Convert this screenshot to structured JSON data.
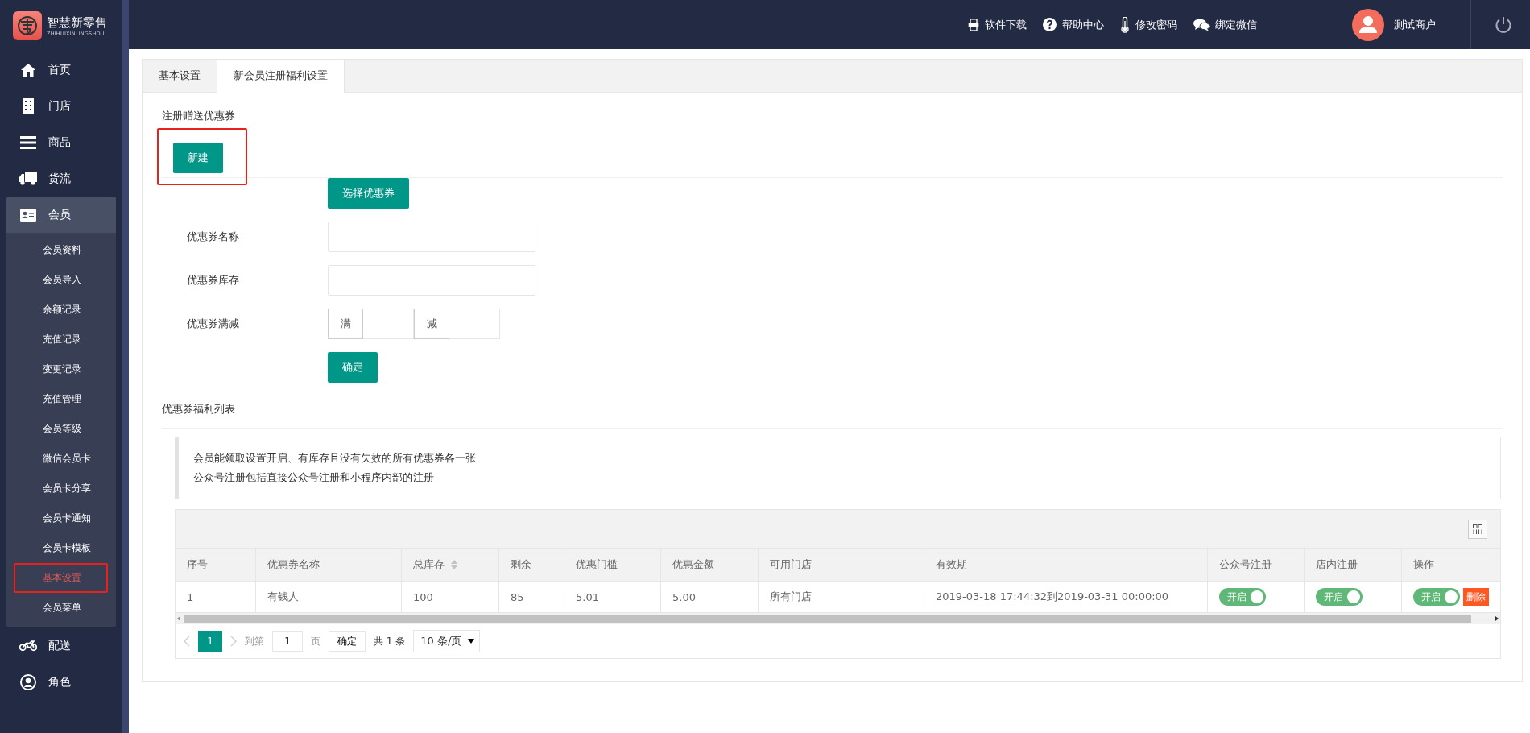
{
  "logo": {
    "title": "智慧新零售",
    "subtitle": "ZHIHUIXINLINGSHOU"
  },
  "sidebar": {
    "items": [
      {
        "label": "首页",
        "selected": false
      },
      {
        "label": "门店",
        "selected": false
      },
      {
        "label": "商品",
        "selected": false
      },
      {
        "label": "货流",
        "selected": false
      },
      {
        "label": "会员",
        "selected": true,
        "expanded": true,
        "children": [
          {
            "label": "会员资料",
            "selected": false
          },
          {
            "label": "会员导入",
            "selected": false
          },
          {
            "label": "余额记录",
            "selected": false
          },
          {
            "label": "充值记录",
            "selected": false
          },
          {
            "label": "变更记录",
            "selected": false
          },
          {
            "label": "充值管理",
            "selected": false
          },
          {
            "label": "会员等级",
            "selected": false
          },
          {
            "label": "微信会员卡",
            "selected": false
          },
          {
            "label": "会员卡分享",
            "selected": false
          },
          {
            "label": "会员卡通知",
            "selected": false
          },
          {
            "label": "会员卡模板",
            "selected": false
          },
          {
            "label": "基本设置",
            "selected": true
          },
          {
            "label": "会员菜单",
            "selected": false
          }
        ]
      },
      {
        "label": "配送",
        "selected": false
      },
      {
        "label": "角色",
        "selected": false
      }
    ]
  },
  "header": {
    "links": [
      "软件下载",
      "帮助中心",
      "修改密码",
      "绑定微信"
    ],
    "user": "测试商户"
  },
  "tabs": [
    {
      "label": "基本设置",
      "selected": false
    },
    {
      "label": "新会员注册福利设置",
      "selected": true
    }
  ],
  "section_title": "注册赠送优惠券",
  "new_button": "新建",
  "select_button": "选择优惠券",
  "fields": [
    {
      "kind": "text",
      "label": "优惠券名称"
    },
    {
      "kind": "text",
      "label": "优惠券库存"
    },
    {
      "kind": "range",
      "label": "优惠券满减",
      "prefix": "满",
      "middle": "减"
    }
  ],
  "confirm_button": "确定",
  "list_title": "优惠券福利列表",
  "notice": [
    "会员能领取设置开启、有库存且没有失效的所有优惠券各一张",
    "公众号注册包括直接公众号注册和小程序内部的注册"
  ],
  "table": {
    "columns": [
      {
        "label": "序号",
        "sortable": false
      },
      {
        "label": "优惠券名称",
        "sortable": false
      },
      {
        "label": "总库存",
        "sortable": true
      },
      {
        "label": "剩余",
        "sortable": false
      },
      {
        "label": "优惠门槛",
        "sortable": false
      },
      {
        "label": "优惠金额",
        "sortable": false
      },
      {
        "label": "可用门店",
        "sortable": false
      },
      {
        "label": "有效期",
        "sortable": false
      },
      {
        "label": "公众号注册",
        "sortable": false
      },
      {
        "label": "店内注册",
        "sortable": false
      },
      {
        "label": "操作",
        "sortable": false
      }
    ],
    "rows": [
      {
        "cells": [
          "1",
          "有钱人",
          "100",
          "85",
          "5.01",
          "5.00",
          "所有门店",
          "2019-03-18 17:44:32到2019-03-31 00:00:00"
        ],
        "wechat_register": {
          "label": "开启",
          "on": true
        },
        "store_register": {
          "label": "开启",
          "on": true
        },
        "operation": {
          "label": "开启",
          "on": true,
          "delete": "删除"
        }
      }
    ]
  },
  "pager": {
    "pages": [
      {
        "label": "1",
        "selected": true
      }
    ],
    "goto_label": "到第",
    "page_value": "1",
    "page_unit": "页",
    "confirm": "确定",
    "total": "共 1 条",
    "page_size": "10 条/页"
  }
}
